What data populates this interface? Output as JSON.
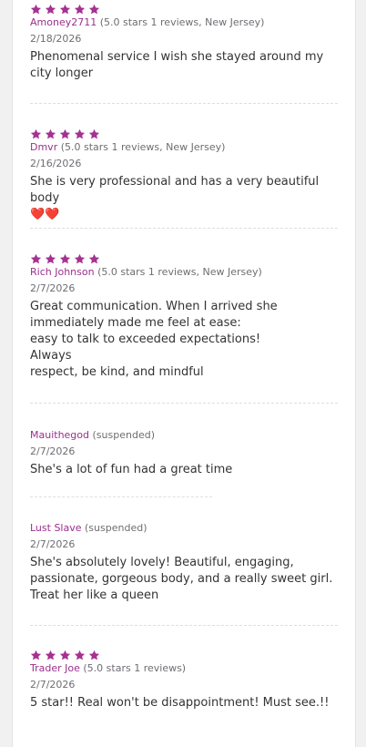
{
  "colors": {
    "accent": "#9b2f8c",
    "star": "#a63192",
    "heart": "#d9263c",
    "meta": "#6e6e73",
    "text": "#333333"
  },
  "reviews": [
    {
      "rating": 5,
      "username": "Amoney2711",
      "details": "(5.0 stars 1 reviews, New Jersey)",
      "date": "2/18/2026",
      "text": "Phenomenal service I wish she stayed around my city longer"
    },
    {
      "rating": 5,
      "username": "Dmvr",
      "details": "(5.0 stars 1 reviews, New Jersey)",
      "date": "2/16/2026",
      "text": "She is very professional and has a very beautiful body",
      "emoji": "❤️❤️"
    },
    {
      "rating": 5,
      "username": "Rich Johnson",
      "details": "(5.0 stars 1 reviews, New Jersey)",
      "date": "2/7/2026",
      "text": "Great communication. When I arrived she immediately made me feel at ease:\neasy to talk to exceeded expectations!\nAlways\nrespect, be kind, and mindful"
    },
    {
      "rating": 0,
      "username": "Mauithegod",
      "details": "(suspended)",
      "date": "2/7/2026",
      "text": "She's a lot of fun had a great time"
    },
    {
      "rating": 0,
      "username": "Lust Slave",
      "details": "(suspended)",
      "date": "2/7/2026",
      "text": "She's absolutely lovely! Beautiful, engaging, passionate, gorgeous body, and a really sweet girl.\nTreat her like a queen"
    },
    {
      "rating": 5,
      "username": "Trader Joe",
      "details": "(5.0 stars 1 reviews)",
      "date": "2/7/2026",
      "text": "5 star!! Real won't be disappointment! Must see.!!"
    }
  ]
}
